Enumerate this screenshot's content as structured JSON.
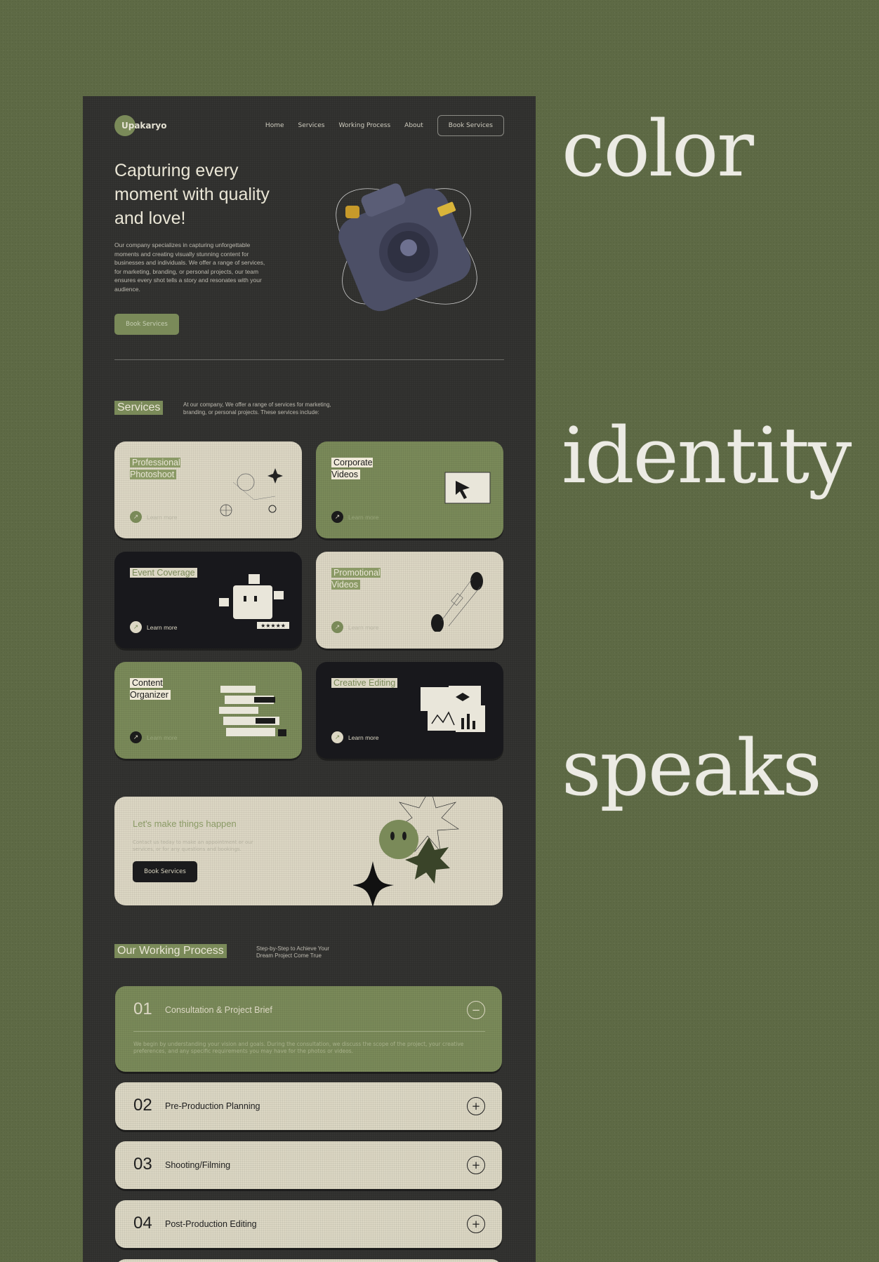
{
  "side_words": [
    "color",
    "identity",
    "speaks"
  ],
  "nav": {
    "logo": "Upakaryo",
    "links": [
      "Home",
      "Services",
      "Working Process",
      "About"
    ],
    "cta": "Book Services"
  },
  "hero": {
    "title": "Capturing every moment with quality and love!",
    "text": "Our company specializes in capturing unforgettable moments and creating visually stunning content for businesses and individuals. We offer a range of services, for marketing, branding, or personal projects, our team ensures every shot tells a story and resonates with your audience.",
    "button": "Book Services"
  },
  "services": {
    "tag": "Services",
    "desc": "At our company, We offer a range of services for marketing, branding, or personal projects. These services include:",
    "learn": "Learn more",
    "cards": [
      {
        "title": "Professional Photoshoot",
        "style": "cream",
        "art": "globe-sparkle-icon"
      },
      {
        "title": "Corporate Videos",
        "style": "green",
        "art": "cursor-window-icon"
      },
      {
        "title": "Event Coverage",
        "style": "dark",
        "art": "rating-face-icon"
      },
      {
        "title": "Promotional Videos",
        "style": "cream",
        "art": "portal-icon"
      },
      {
        "title": "Content Organizer",
        "style": "green",
        "art": "stack-list-icon"
      },
      {
        "title": "Creative Editing",
        "style": "dark",
        "art": "charts-windows-icon"
      }
    ]
  },
  "cta": {
    "title": "Let's make things happen",
    "text": "Contact us today to make an appointment or our services, or for any questions and bookings.",
    "button": "Book Services"
  },
  "process": {
    "tag": "Our Working Process",
    "desc": "Step-by-Step to Achieve Your Dream Project Come True",
    "steps": [
      {
        "num": "01",
        "title": "Consultation & Project Brief",
        "open": true,
        "toggle": "−",
        "body": "We begin by understanding your vision and goals. During the consultation, we discuss the scope of the project, your creative preferences, and any specific requirements you may have for the photos or videos."
      },
      {
        "num": "02",
        "title": "Pre-Production Planning",
        "open": false,
        "toggle": "+"
      },
      {
        "num": "03",
        "title": "Shooting/Filming",
        "open": false,
        "toggle": "+"
      },
      {
        "num": "04",
        "title": "Post-Production Editing",
        "open": false,
        "toggle": "+"
      }
    ]
  },
  "colors": {
    "accent": "#7a8a59",
    "page": "#2f2f2d",
    "cream": "#dcd7c4",
    "dark": "#18181c"
  }
}
